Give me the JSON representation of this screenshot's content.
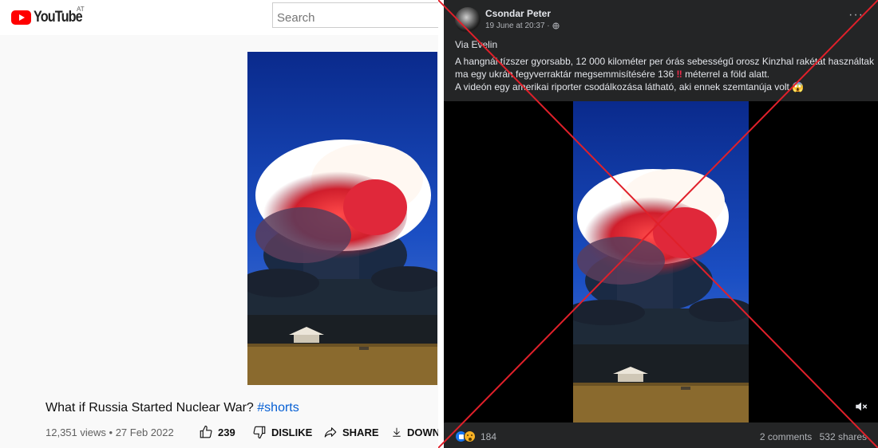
{
  "colors": {
    "youtube_red": "#ff0000",
    "hashtag_blue": "#065fd4",
    "facebook_dark": "#242526",
    "cross_red": "#e0202a"
  },
  "youtube": {
    "logo_text": "YouTube",
    "region": "AT",
    "search_placeholder": "Search",
    "video_title": "What if Russia Started Nuclear War?",
    "hashtag": "#shorts",
    "views": "12,351 views",
    "separator": "•",
    "date": "27 Feb 2022",
    "like_count": "239",
    "dislike_label": "DISLIKE",
    "share_label": "SHARE",
    "download_label": "DOWN"
  },
  "facebook": {
    "author": "Csondar Peter",
    "timestamp": "19 June at 20:37 ·",
    "more_label": "···",
    "lines": {
      "via": "Via Evelin",
      "line1": "A hangnál tízszer gyorsabb, 12 000 kilométer per órás sebességű orosz Kinzhal rakétát használtak",
      "line2_a": "ma egy ukrán fegyverraktár megsemmisítésére 136",
      "line2_bang": "‼",
      "line2_b": "méterrel a föld alatt.",
      "line3": "A videón egy amerikai riporter csodálkozása látható, aki ennek szemtanúja volt.😱"
    },
    "reaction_count": "184",
    "comments": "2 comments",
    "shares": "532 shares",
    "icons": [
      "like-reaction-icon",
      "wow-reaction-icon",
      "mute-icon",
      "globe-icon",
      "more-options-icon"
    ]
  }
}
